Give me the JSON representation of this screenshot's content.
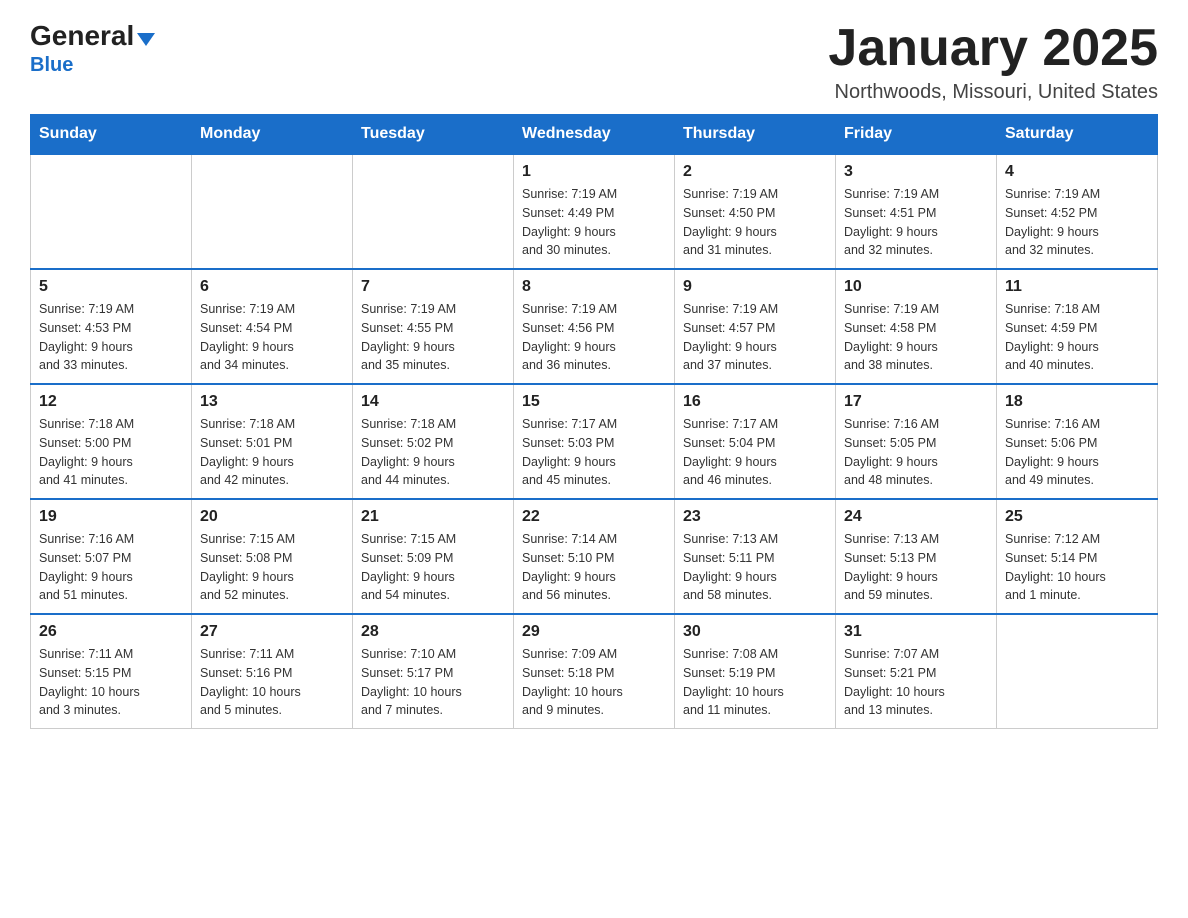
{
  "header": {
    "logo_line1": "General",
    "logo_triangle": "▶",
    "logo_line2": "Blue",
    "month_title": "January 2025",
    "location": "Northwoods, Missouri, United States"
  },
  "weekdays": [
    "Sunday",
    "Monday",
    "Tuesday",
    "Wednesday",
    "Thursday",
    "Friday",
    "Saturday"
  ],
  "weeks": [
    [
      {
        "day": "",
        "info": ""
      },
      {
        "day": "",
        "info": ""
      },
      {
        "day": "",
        "info": ""
      },
      {
        "day": "1",
        "info": "Sunrise: 7:19 AM\nSunset: 4:49 PM\nDaylight: 9 hours\nand 30 minutes."
      },
      {
        "day": "2",
        "info": "Sunrise: 7:19 AM\nSunset: 4:50 PM\nDaylight: 9 hours\nand 31 minutes."
      },
      {
        "day": "3",
        "info": "Sunrise: 7:19 AM\nSunset: 4:51 PM\nDaylight: 9 hours\nand 32 minutes."
      },
      {
        "day": "4",
        "info": "Sunrise: 7:19 AM\nSunset: 4:52 PM\nDaylight: 9 hours\nand 32 minutes."
      }
    ],
    [
      {
        "day": "5",
        "info": "Sunrise: 7:19 AM\nSunset: 4:53 PM\nDaylight: 9 hours\nand 33 minutes."
      },
      {
        "day": "6",
        "info": "Sunrise: 7:19 AM\nSunset: 4:54 PM\nDaylight: 9 hours\nand 34 minutes."
      },
      {
        "day": "7",
        "info": "Sunrise: 7:19 AM\nSunset: 4:55 PM\nDaylight: 9 hours\nand 35 minutes."
      },
      {
        "day": "8",
        "info": "Sunrise: 7:19 AM\nSunset: 4:56 PM\nDaylight: 9 hours\nand 36 minutes."
      },
      {
        "day": "9",
        "info": "Sunrise: 7:19 AM\nSunset: 4:57 PM\nDaylight: 9 hours\nand 37 minutes."
      },
      {
        "day": "10",
        "info": "Sunrise: 7:19 AM\nSunset: 4:58 PM\nDaylight: 9 hours\nand 38 minutes."
      },
      {
        "day": "11",
        "info": "Sunrise: 7:18 AM\nSunset: 4:59 PM\nDaylight: 9 hours\nand 40 minutes."
      }
    ],
    [
      {
        "day": "12",
        "info": "Sunrise: 7:18 AM\nSunset: 5:00 PM\nDaylight: 9 hours\nand 41 minutes."
      },
      {
        "day": "13",
        "info": "Sunrise: 7:18 AM\nSunset: 5:01 PM\nDaylight: 9 hours\nand 42 minutes."
      },
      {
        "day": "14",
        "info": "Sunrise: 7:18 AM\nSunset: 5:02 PM\nDaylight: 9 hours\nand 44 minutes."
      },
      {
        "day": "15",
        "info": "Sunrise: 7:17 AM\nSunset: 5:03 PM\nDaylight: 9 hours\nand 45 minutes."
      },
      {
        "day": "16",
        "info": "Sunrise: 7:17 AM\nSunset: 5:04 PM\nDaylight: 9 hours\nand 46 minutes."
      },
      {
        "day": "17",
        "info": "Sunrise: 7:16 AM\nSunset: 5:05 PM\nDaylight: 9 hours\nand 48 minutes."
      },
      {
        "day": "18",
        "info": "Sunrise: 7:16 AM\nSunset: 5:06 PM\nDaylight: 9 hours\nand 49 minutes."
      }
    ],
    [
      {
        "day": "19",
        "info": "Sunrise: 7:16 AM\nSunset: 5:07 PM\nDaylight: 9 hours\nand 51 minutes."
      },
      {
        "day": "20",
        "info": "Sunrise: 7:15 AM\nSunset: 5:08 PM\nDaylight: 9 hours\nand 52 minutes."
      },
      {
        "day": "21",
        "info": "Sunrise: 7:15 AM\nSunset: 5:09 PM\nDaylight: 9 hours\nand 54 minutes."
      },
      {
        "day": "22",
        "info": "Sunrise: 7:14 AM\nSunset: 5:10 PM\nDaylight: 9 hours\nand 56 minutes."
      },
      {
        "day": "23",
        "info": "Sunrise: 7:13 AM\nSunset: 5:11 PM\nDaylight: 9 hours\nand 58 minutes."
      },
      {
        "day": "24",
        "info": "Sunrise: 7:13 AM\nSunset: 5:13 PM\nDaylight: 9 hours\nand 59 minutes."
      },
      {
        "day": "25",
        "info": "Sunrise: 7:12 AM\nSunset: 5:14 PM\nDaylight: 10 hours\nand 1 minute."
      }
    ],
    [
      {
        "day": "26",
        "info": "Sunrise: 7:11 AM\nSunset: 5:15 PM\nDaylight: 10 hours\nand 3 minutes."
      },
      {
        "day": "27",
        "info": "Sunrise: 7:11 AM\nSunset: 5:16 PM\nDaylight: 10 hours\nand 5 minutes."
      },
      {
        "day": "28",
        "info": "Sunrise: 7:10 AM\nSunset: 5:17 PM\nDaylight: 10 hours\nand 7 minutes."
      },
      {
        "day": "29",
        "info": "Sunrise: 7:09 AM\nSunset: 5:18 PM\nDaylight: 10 hours\nand 9 minutes."
      },
      {
        "day": "30",
        "info": "Sunrise: 7:08 AM\nSunset: 5:19 PM\nDaylight: 10 hours\nand 11 minutes."
      },
      {
        "day": "31",
        "info": "Sunrise: 7:07 AM\nSunset: 5:21 PM\nDaylight: 10 hours\nand 13 minutes."
      },
      {
        "day": "",
        "info": ""
      }
    ]
  ]
}
